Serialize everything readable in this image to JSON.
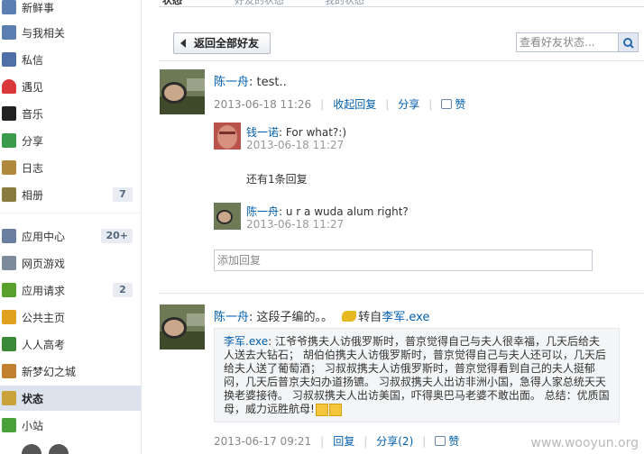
{
  "sidebar": {
    "items": [
      {
        "label": "新鲜事",
        "icon": "feed-icon",
        "color": "#5b7fb0"
      },
      {
        "label": "与我相关",
        "icon": "related-icon",
        "color": "#5b7fb0"
      },
      {
        "label": "私信",
        "icon": "message-icon",
        "color": "#4f6fa8"
      },
      {
        "label": "遇见",
        "icon": "heart-icon",
        "color": "#d9383a"
      },
      {
        "label": "音乐",
        "icon": "music-icon",
        "color": "#222222"
      },
      {
        "label": "分享",
        "icon": "share-icon",
        "color": "#3c9a4c"
      },
      {
        "label": "日志",
        "icon": "blog-icon",
        "color": "#b08a3c"
      },
      {
        "label": "相册",
        "icon": "album-icon",
        "color": "#8a7a3c",
        "count": "7"
      },
      {
        "label": "应用中心",
        "icon": "app-center-icon",
        "color": "#6a7fa0",
        "count": "20+"
      },
      {
        "label": "网页游戏",
        "icon": "gamepad-icon",
        "color": "#7d8a99"
      },
      {
        "label": "应用请求",
        "icon": "puzzle-icon",
        "color": "#5aa02c",
        "count": "2"
      },
      {
        "label": "公共主页",
        "icon": "bookmark-icon",
        "color": "#e0a020"
      },
      {
        "label": "人人高考",
        "icon": "question-icon",
        "color": "#3a8a3a"
      },
      {
        "label": "新梦幻之城",
        "icon": "game-icon",
        "color": "#c08030"
      },
      {
        "label": "状态",
        "icon": "status-icon",
        "color": "#c9a23a"
      },
      {
        "label": "小站",
        "icon": "station-icon",
        "color": "#4aa03a"
      }
    ]
  },
  "top_tabs": [
    "状态",
    "好友的状态",
    "我的状态"
  ],
  "back_button": "返回全部好友",
  "search": {
    "placeholder": "查看好友状态..."
  },
  "feed1": {
    "name": "陈一舟",
    "text": ": test..",
    "time": "2013-06-18 11:26",
    "actions": [
      "收起回复",
      "分享",
      "赞"
    ],
    "replies": [
      {
        "name": "钱一诺",
        "text": ": For what?:)",
        "time": "2013-06-18 11:27"
      },
      {
        "name": "陈一舟",
        "text": ": u r a wuda alum right?",
        "time": "2013-06-18 11:27"
      }
    ],
    "more_replies": "还有1条回复",
    "add_reply_placeholder": "添加回复"
  },
  "feed2": {
    "name": "陈一舟",
    "text": ": 这段子编的。。",
    "forward_label": "转自",
    "forward_user": "李军.exe",
    "quote_name": "李军.exe",
    "quote_text": ": 江爷爷携夫人访俄罗斯时，普京觉得自己与夫人很幸福，几天后给夫人送去大钻石； 胡伯伯携夫人访俄罗斯时，普京觉得自己与夫人还可以，几天后给夫人送了葡萄酒； 习叔叔携夫人访俄罗斯时，普京觉得看到自己的夫人挺郁闷，几天后普京夫妇办道扬镳。 习叔叔携夫人出访非洲小国，急得人家总统天天换老婆接待。 习叔叔携夫人出访美国，吓得奥巴马老婆不敢出面。 总结：优质国母，威力远胜航母!",
    "time": "2013-06-17 09:21",
    "actions": [
      "回复",
      "分享(2)",
      "赞"
    ]
  },
  "watermark": "www.wooyun.org"
}
